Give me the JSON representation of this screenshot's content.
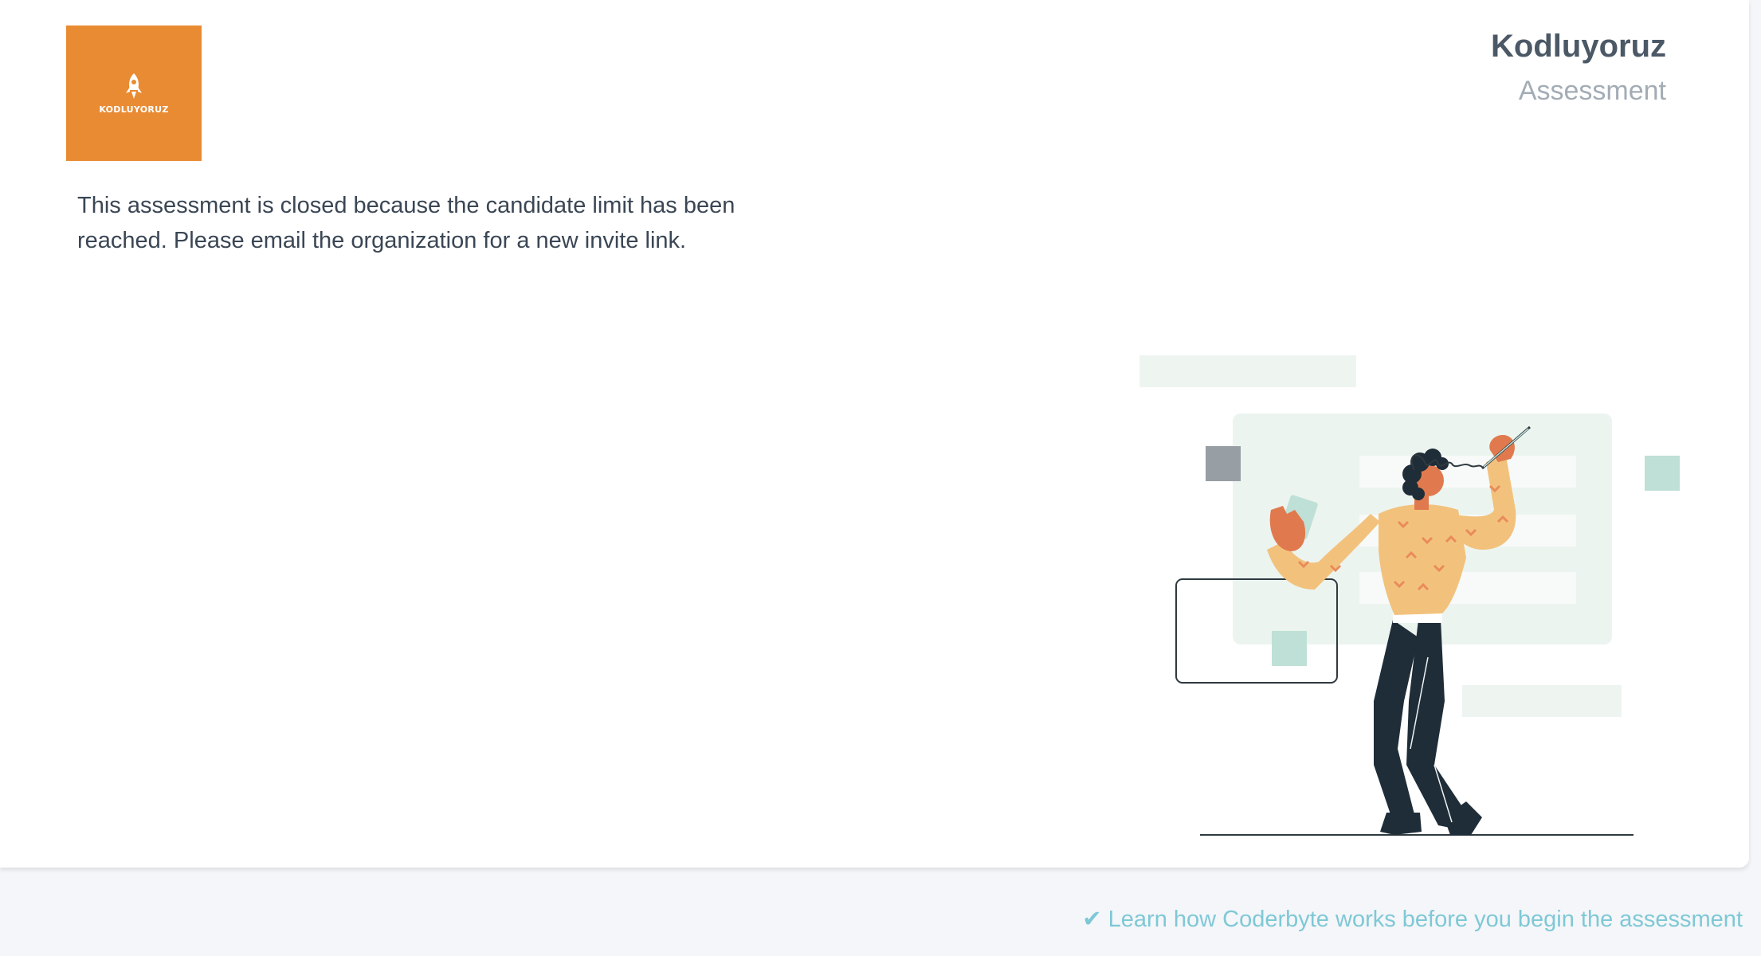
{
  "logo": {
    "text": "KODLUYORUZ",
    "icon": "rocket-icon",
    "background_color": "#e98b33"
  },
  "header": {
    "org_name": "Kodluyoruz",
    "subtitle": "Assessment"
  },
  "message": {
    "text": "This assessment is closed because the candidate limit has been reached. Please email the organization for a new invite link."
  },
  "footer": {
    "check_icon": "✔",
    "link_text": "Learn how Coderbyte works before you begin the assessment",
    "link_color": "#7fc8d6"
  },
  "illustration": {
    "name": "person-drawing-illustration"
  }
}
